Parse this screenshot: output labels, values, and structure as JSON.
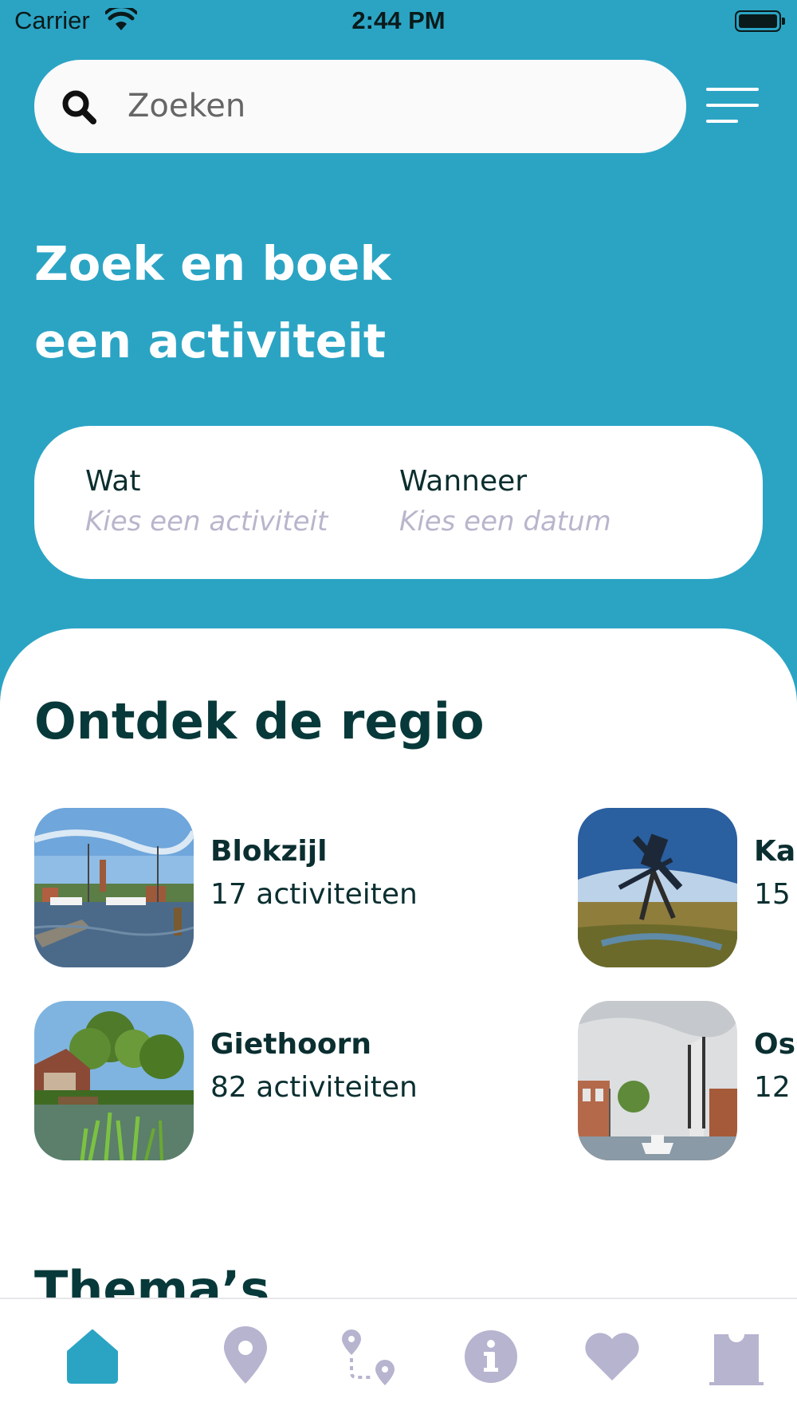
{
  "status_bar": {
    "carrier": "Carrier",
    "time": "2:44 PM"
  },
  "search": {
    "placeholder": "Zoeken"
  },
  "hero": {
    "title_line1": "Zoek en boek",
    "title_line2": "een activiteit"
  },
  "booking": {
    "what_label": "Wat",
    "what_value": "Kies een activiteit",
    "when_label": "Wanneer",
    "when_value": "Kies een datum"
  },
  "discover": {
    "title": "Ontdek de regio",
    "regions": [
      {
        "name": "Blokzijl",
        "count": "17 activiteiten"
      },
      {
        "name": "Kal",
        "count": "15"
      },
      {
        "name": "Giethoorn",
        "count": "82 activiteiten"
      },
      {
        "name": "Oss",
        "count": "12"
      }
    ]
  },
  "themes": {
    "title": "Thema’s"
  },
  "tab_bar": {
    "tabs": [
      {
        "icon": "home-icon",
        "active": true
      },
      {
        "icon": "map-pin-icon",
        "active": false
      },
      {
        "icon": "route-icon",
        "active": false
      },
      {
        "icon": "info-icon",
        "active": false
      },
      {
        "icon": "heart-icon",
        "active": false
      },
      {
        "icon": "ticket-icon",
        "active": false
      }
    ]
  },
  "colors": {
    "brand_blue": "#2ba4c4",
    "dark_teal": "#08393a",
    "inactive_icon": "#b6b4cf",
    "placeholder_purple": "#b8b6cc"
  }
}
